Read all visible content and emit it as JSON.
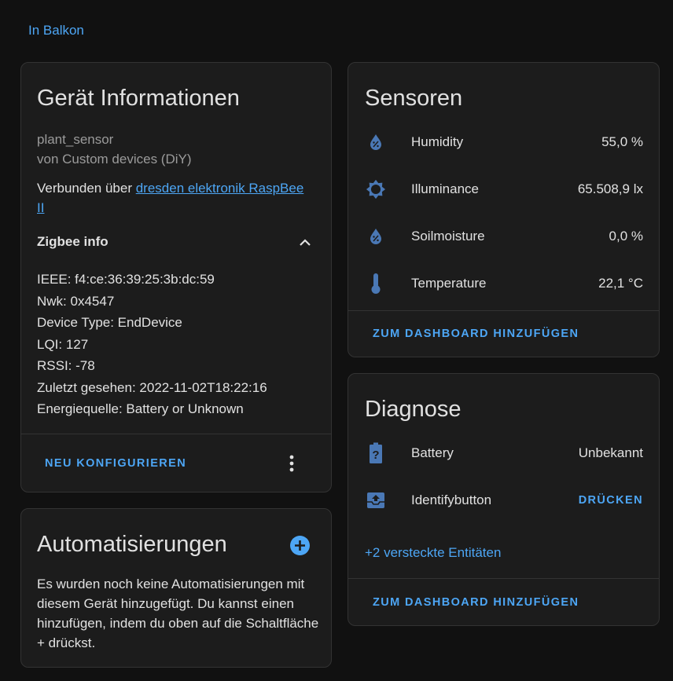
{
  "area": {
    "label": "In Balkon"
  },
  "device_info": {
    "title": "Gerät Informationen",
    "model": "plant_sensor",
    "manufacturer": "von Custom devices (DiY)",
    "connected_prefix": "Verbunden über ",
    "connected_link": "dresden elektronik RaspBee II",
    "zigbee": {
      "title": "Zigbee info",
      "lines": [
        "IEEE: f4:ce:36:39:25:3b:dc:59",
        "Nwk: 0x4547",
        "Device Type: EndDevice",
        "LQI: 127",
        "RSSI: -78",
        "Zuletzt gesehen: 2022-11-02T18:22:16",
        "Energiequelle: Battery or Unknown"
      ]
    },
    "reconfigure_label": "NEU KONFIGURIEREN"
  },
  "automations": {
    "title": "Automatisierungen",
    "empty_text": "Es wurden noch keine Automatisierungen mit diesem Gerät hinzugefügt. Du kannst einen hinzufügen, indem du oben auf die Schaltfläche + drückst."
  },
  "sensors": {
    "title": "Sensoren",
    "items": [
      {
        "name": "Humidity",
        "value": "55,0 %",
        "icon": "water-percent-icon"
      },
      {
        "name": "Illuminance",
        "value": "65.508,9 lx",
        "icon": "brightness-icon"
      },
      {
        "name": "Soilmoisture",
        "value": "0,0 %",
        "icon": "water-percent-icon"
      },
      {
        "name": "Temperature",
        "value": "22,1 °C",
        "icon": "thermometer-icon"
      }
    ],
    "add_label": "ZUM DASHBOARD HINZUFÜGEN"
  },
  "diagnose": {
    "title": "Diagnose",
    "items": [
      {
        "name": "Battery",
        "value": "Unbekannt",
        "icon": "battery-unknown-icon"
      },
      {
        "name": "Identifybutton",
        "value": "DRÜCKEN",
        "icon": "inbox-arrow-up-icon"
      }
    ],
    "hidden_label": "+2 versteckte Entitäten",
    "add_label": "ZUM DASHBOARD HINZUFÜGEN"
  },
  "colors": {
    "accent": "#4da6f5",
    "icon": "#4a78b5",
    "card": "#1c1c1c",
    "background": "#111111"
  }
}
